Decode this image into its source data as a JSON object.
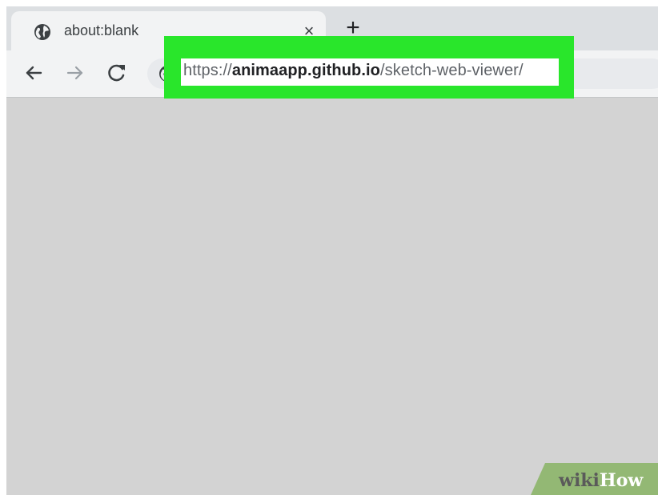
{
  "tab": {
    "title": "about:blank",
    "close_glyph": "×",
    "favicon": "globe-icon"
  },
  "new_tab_glyph": "+",
  "toolbar": {
    "back_icon": "arrow-left-icon",
    "forward_icon": "arrow-right-icon",
    "reload_icon": "reload-icon",
    "site_info_icon": "globe-icon"
  },
  "address_bar": {
    "scheme": "https://",
    "host": "animaapp.github.io",
    "path": "/sketch-web-viewer/"
  },
  "highlight_color": "#29e62b",
  "watermark": {
    "wiki": "wiki",
    "how": "How"
  }
}
